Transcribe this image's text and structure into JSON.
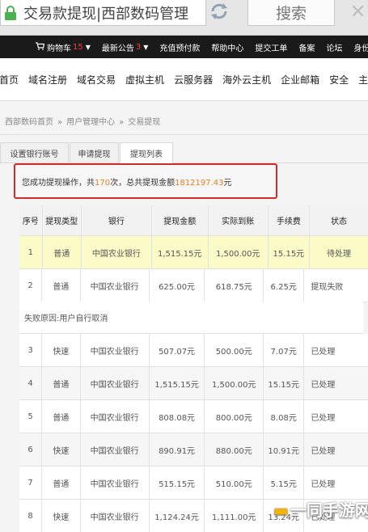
{
  "search": {
    "address": "交易款提现|西部数码管理",
    "button_label": "搜索",
    "close": "×"
  },
  "topnav": {
    "cart_label": "购物车",
    "cart_count": "15",
    "notice_label": "最新公告",
    "notice_count": "3",
    "items": [
      "充值预付款",
      "帮助中心",
      "提交工单",
      "备案",
      "论坛",
      "身份"
    ]
  },
  "mainnav": {
    "items": [
      "首页",
      "域名注册",
      "域名交易",
      "虚拟主机",
      "云服务器",
      "海外云主机",
      "企业邮箱",
      "安全",
      "主"
    ]
  },
  "breadcrumb": [
    "西部数码首页",
    "用户管理中心",
    "交易提现"
  ],
  "tabs": [
    "设置银行账号",
    "申请提现",
    "提现列表"
  ],
  "message": {
    "prefix": "您成功提现操作，共",
    "count": "170",
    "middle": "次，总共提现金额",
    "amount": "1812197.43",
    "suffix": "元"
  },
  "table": {
    "headers": [
      "序号",
      "提现类型",
      "银行",
      "提现金额",
      "实际到账",
      "手续费",
      "状态"
    ],
    "rows": [
      [
        "1",
        "普通",
        "中国农业银行",
        "1,515.15元",
        "1,500.00元",
        "15.15元",
        "待处理"
      ],
      [
        "2",
        "普通",
        "中国农业银行",
        "625.00元",
        "618.75元",
        "6.25元",
        "提现失败"
      ]
    ],
    "fail_reason": "失败原因:用户自行取消",
    "rows2": [
      [
        "3",
        "快速",
        "中国农业银行",
        "507.07元",
        "500.00元",
        "7.07元",
        "已处理"
      ],
      [
        "4",
        "普通",
        "中国农业银行",
        "1,515.15元",
        "1,500.00元",
        "15.15元",
        "已处理"
      ],
      [
        "5",
        "普通",
        "中国农业银行",
        "808.08元",
        "800.00元",
        "8.08元",
        "已处理"
      ],
      [
        "6",
        "快速",
        "中国农业银行",
        "890.91元",
        "880.00元",
        "10.91元",
        "已处理"
      ],
      [
        "7",
        "普通",
        "中国农业银行",
        "515.15元",
        "510.00元",
        "5.15元",
        "已处理"
      ],
      [
        "8",
        "快速",
        "中国农业银行",
        "1,124.24元",
        "1,111.00元",
        "13.24元",
        "已处理"
      ]
    ]
  },
  "watermark": "一同手游网",
  "colors": {
    "highlight_row": "#fbfbc8",
    "message_border": "#d42a2a",
    "message_accent": "#e67e22",
    "topnav_bg": "#1a1a1a",
    "count_red": "#ff3b3b"
  }
}
